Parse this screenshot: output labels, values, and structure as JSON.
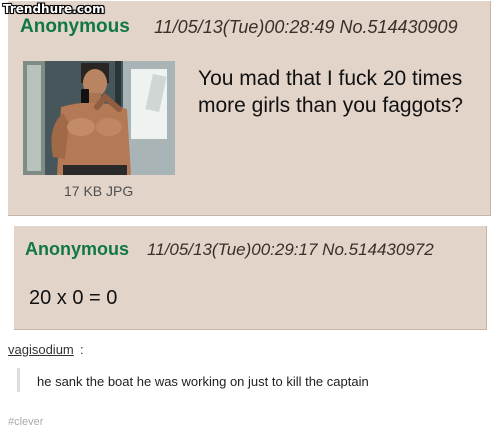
{
  "watermark": "Trendhure.com",
  "post1": {
    "name": "Anonymous",
    "meta": "11/05/13(Tue)00:28:49 No.514430909",
    "comment": "You mad that I fuck 20 times more girls than you faggots?",
    "filesize": "17 KB JPG"
  },
  "post2": {
    "name": "Anonymous",
    "meta": "11/05/13(Tue)00:29:17 No.514430972",
    "comment": "20 x 0 = 0"
  },
  "tumblr": {
    "username": "vagisodium",
    "colon": ":",
    "quote": "he sank the boat he was working on just to kill the captain",
    "tag": "#clever"
  },
  "colors": {
    "post_bg": "#e3d4c9",
    "name_green": "#117743"
  }
}
